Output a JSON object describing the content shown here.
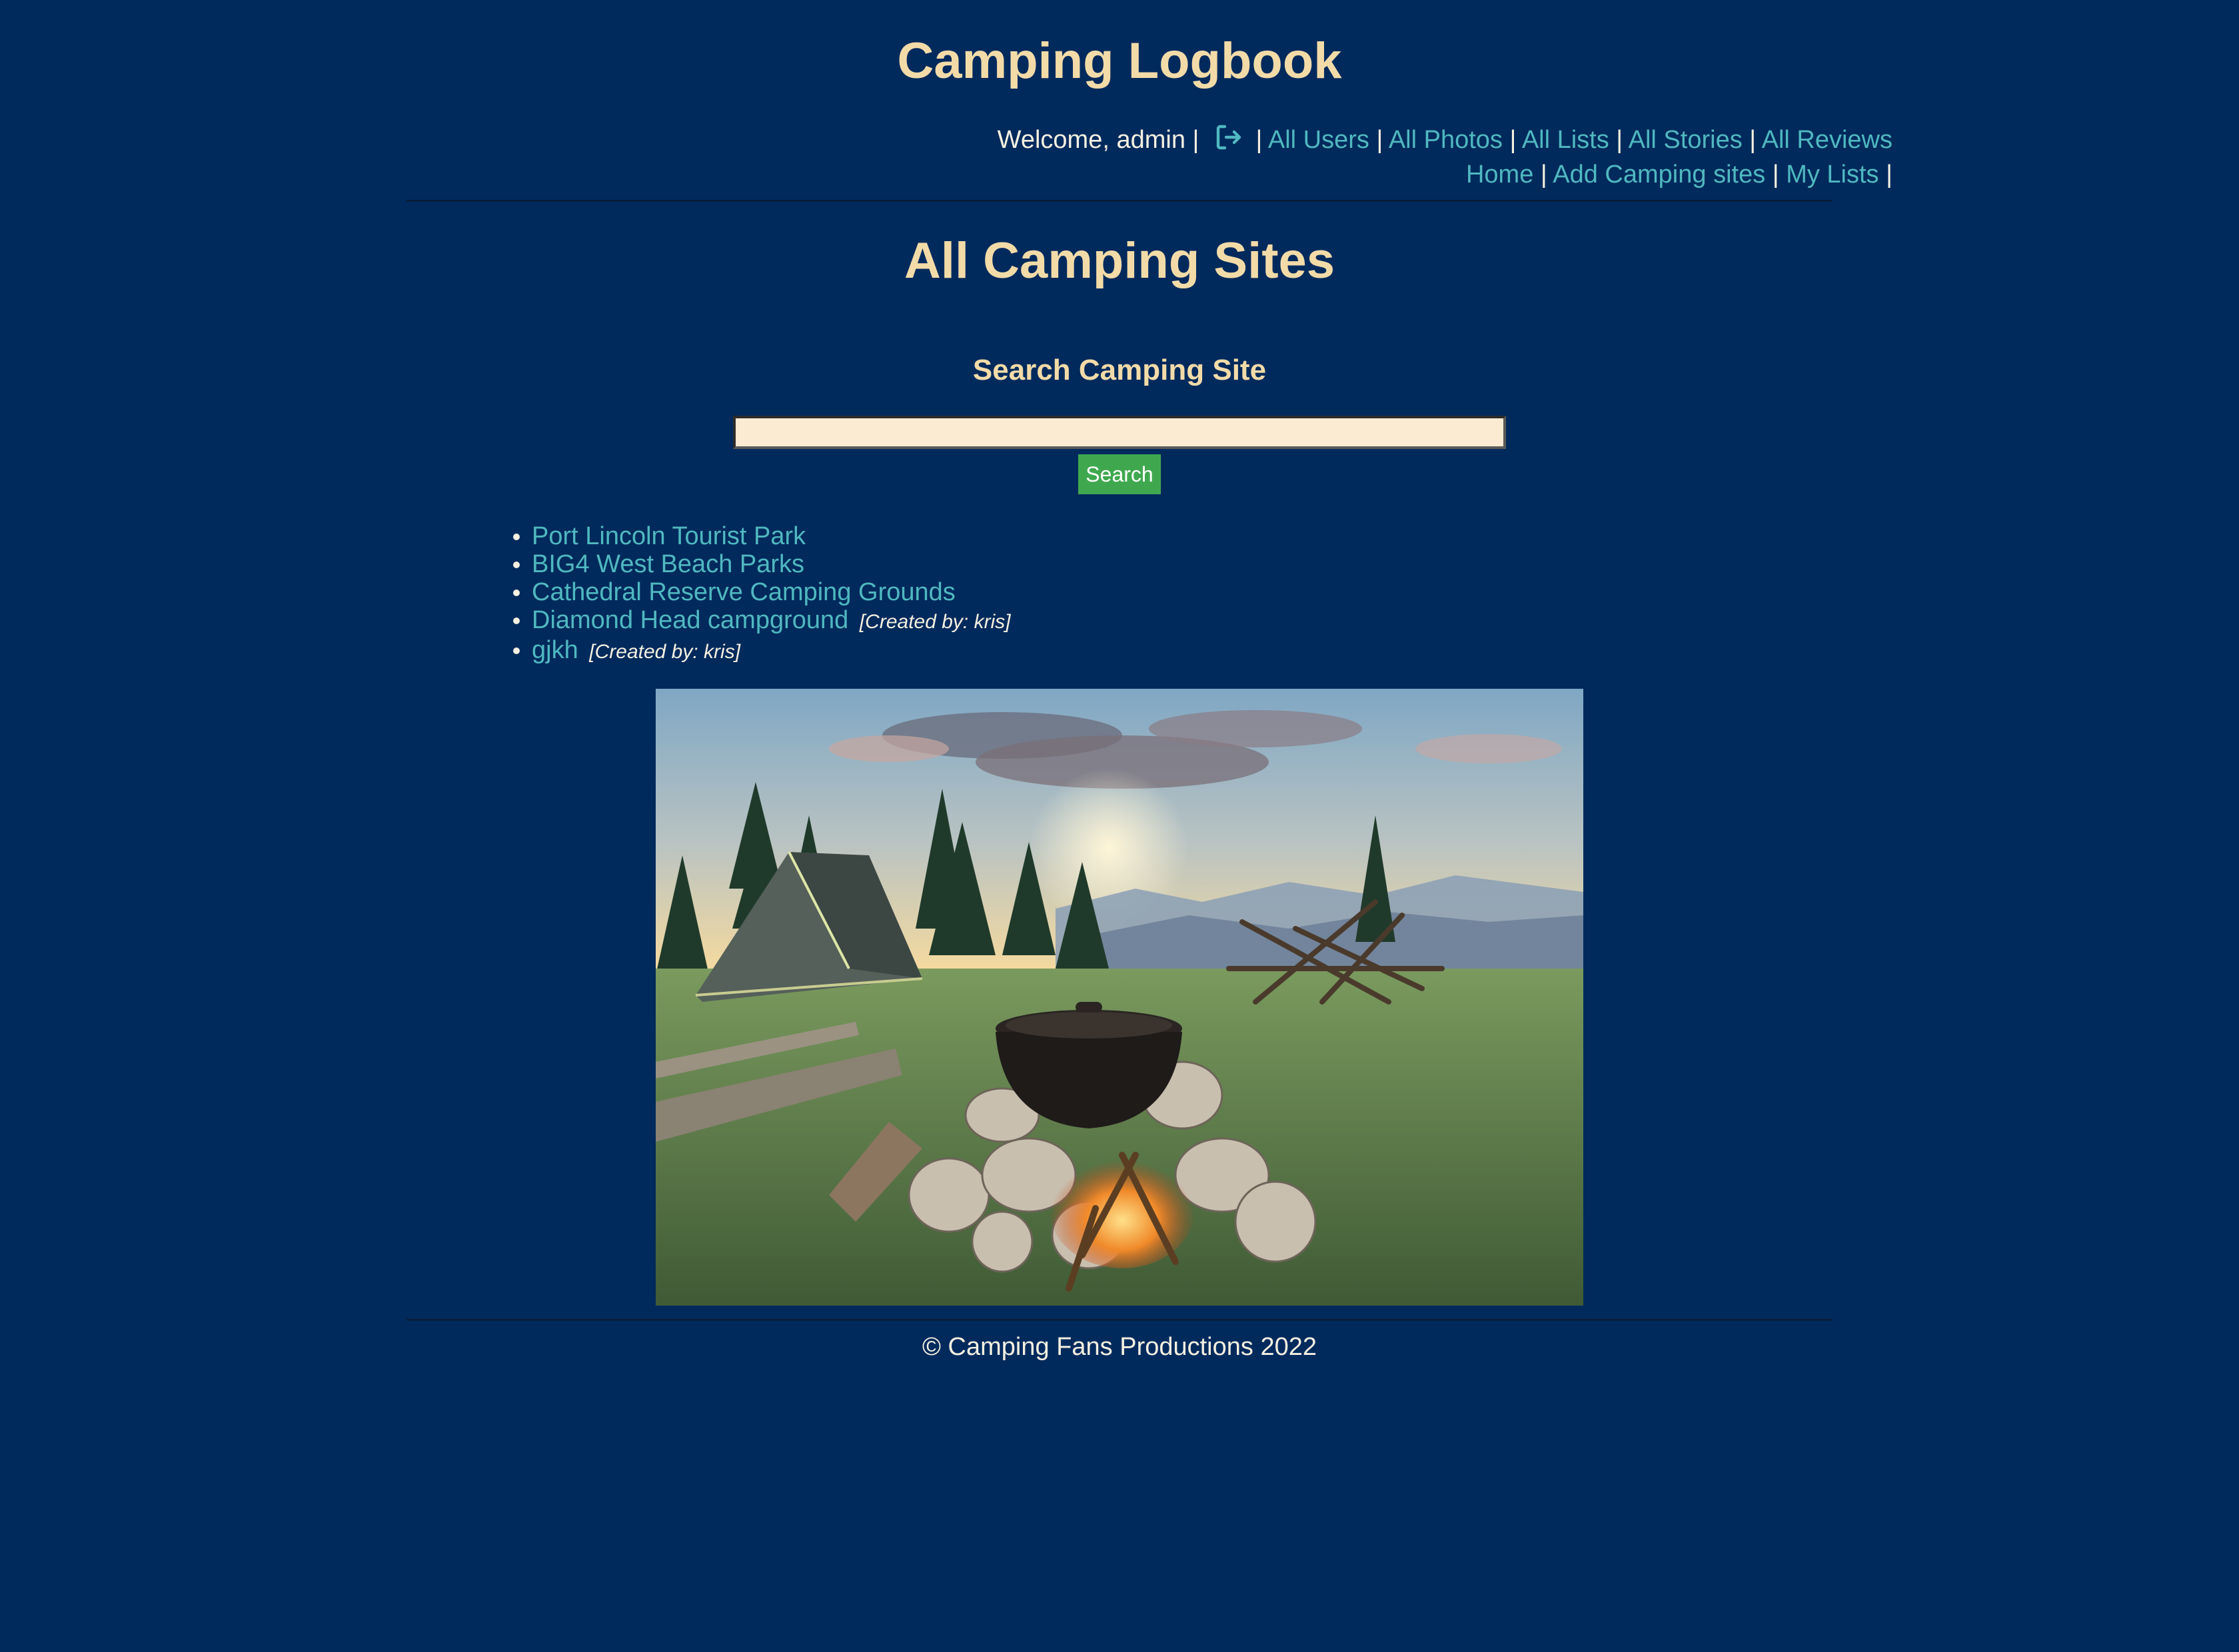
{
  "header": {
    "site_title": "Camping Logbook",
    "welcome_text": "Welcome, admin",
    "separator": "|",
    "logout_icon": "logout-icon",
    "nav_row1": [
      "All Users",
      "All Photos",
      "All Lists",
      "All Stories",
      "All Reviews"
    ],
    "nav_row2": [
      "Home",
      "Add Camping sites",
      "My Lists"
    ]
  },
  "main": {
    "page_title": "All Camping Sites",
    "search": {
      "heading": "Search Camping Site",
      "input_value": "",
      "input_placeholder": "",
      "button_label": "Search"
    },
    "sites": [
      {
        "name": "Port Lincoln Tourist Park",
        "creator": ""
      },
      {
        "name": "BIG4 West Beach Parks",
        "creator": ""
      },
      {
        "name": "Cathedral Reserve Camping Grounds",
        "creator": ""
      },
      {
        "name": "Diamond Head campground",
        "creator": "[Created by: kris]"
      },
      {
        "name": "gjkh",
        "creator": "[Created by: kris]"
      }
    ],
    "hero_image": "campsite-photo"
  },
  "footer": {
    "copyright": "© Camping Fans Productions 2022"
  },
  "colors": {
    "background": "#002a5c",
    "heading": "#f3dba8",
    "link": "#4fb8c0",
    "text": "#f5f0e1",
    "button": "#3fa84f",
    "input_bg": "#fcebd3"
  }
}
